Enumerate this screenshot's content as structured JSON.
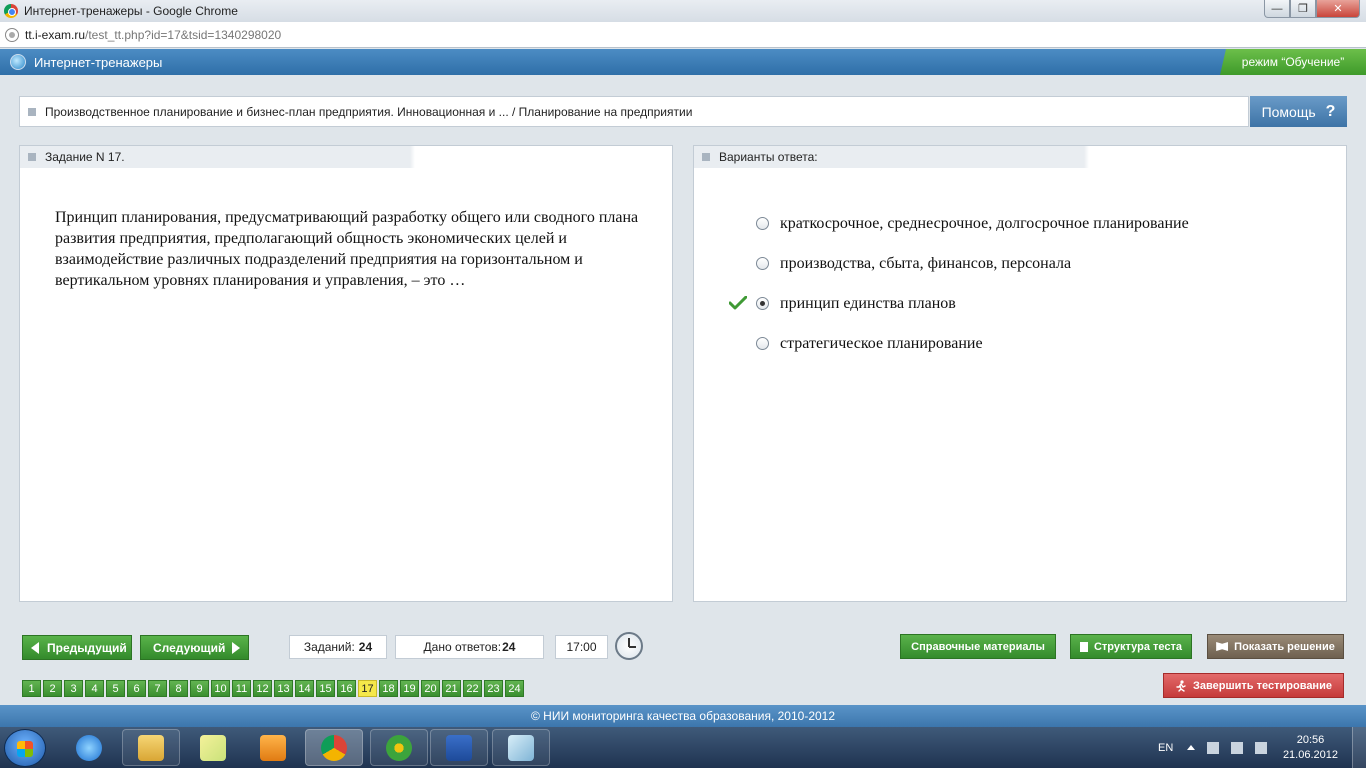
{
  "window": {
    "title": "Интернет-тренажеры - Google Chrome",
    "minimize": "—",
    "maximize": "❐",
    "close": "✕"
  },
  "address": {
    "host": "tt.i-exam.ru",
    "path": "/test_tt.php?id=17&tsid=1340298020"
  },
  "app": {
    "title": "Интернет-тренажеры",
    "mode": "режим “Обучение”"
  },
  "breadcrumb": {
    "text": "Производственное планирование и бизнес-план предприятия. Инновационная и ... / Планирование на предприятии",
    "help_label": "Помощь",
    "help_symbol": "?"
  },
  "task": {
    "header": "Задание N 17.",
    "question": "Принцип планирования, предусматривающий разработку общего или сводного плана развития предприятия, предполагающий общность экономических целей и взаимодействие различных подразделений предприятия на горизонтальном и вертикальном уровнях планирования и управления, – это …"
  },
  "answers": {
    "header": "Варианты ответа:",
    "options": [
      {
        "label": "краткосрочное, среднесрочное, долгосрочное планирование",
        "selected": false,
        "correct": false
      },
      {
        "label": "производства, сбыта, финансов, персонала",
        "selected": false,
        "correct": false
      },
      {
        "label": "принцип единства планов",
        "selected": true,
        "correct": true
      },
      {
        "label": "стратегическое планирование",
        "selected": false,
        "correct": false
      }
    ]
  },
  "controls": {
    "prev_label": "Предыдущий",
    "next_label": "Следующий",
    "tasks_label": "Заданий:",
    "tasks_count": "24",
    "answered_label": "Дано ответов:",
    "answered_count": "24",
    "timer": "17:00",
    "reference_label": "Справочные материалы",
    "structure_label": "Структура теста",
    "solution_label": "Показать решение",
    "finish_label": "Завершить тестирование",
    "pages": [
      "1",
      "2",
      "3",
      "4",
      "5",
      "6",
      "7",
      "8",
      "9",
      "10",
      "11",
      "12",
      "13",
      "14",
      "15",
      "16",
      "17",
      "18",
      "19",
      "20",
      "21",
      "22",
      "23",
      "24"
    ],
    "current_page": "17"
  },
  "footer": {
    "text": "© НИИ мониторинга качества образования, 2010-2012"
  },
  "taskbar": {
    "lang": "EN",
    "time": "20:56",
    "date": "21.06.2012"
  },
  "colors": {
    "accent_blue": "#3d76ad",
    "nav_green": "#3f9a35",
    "current_page_yellow": "#f5e84a",
    "finish_red": "#c53a3a"
  }
}
